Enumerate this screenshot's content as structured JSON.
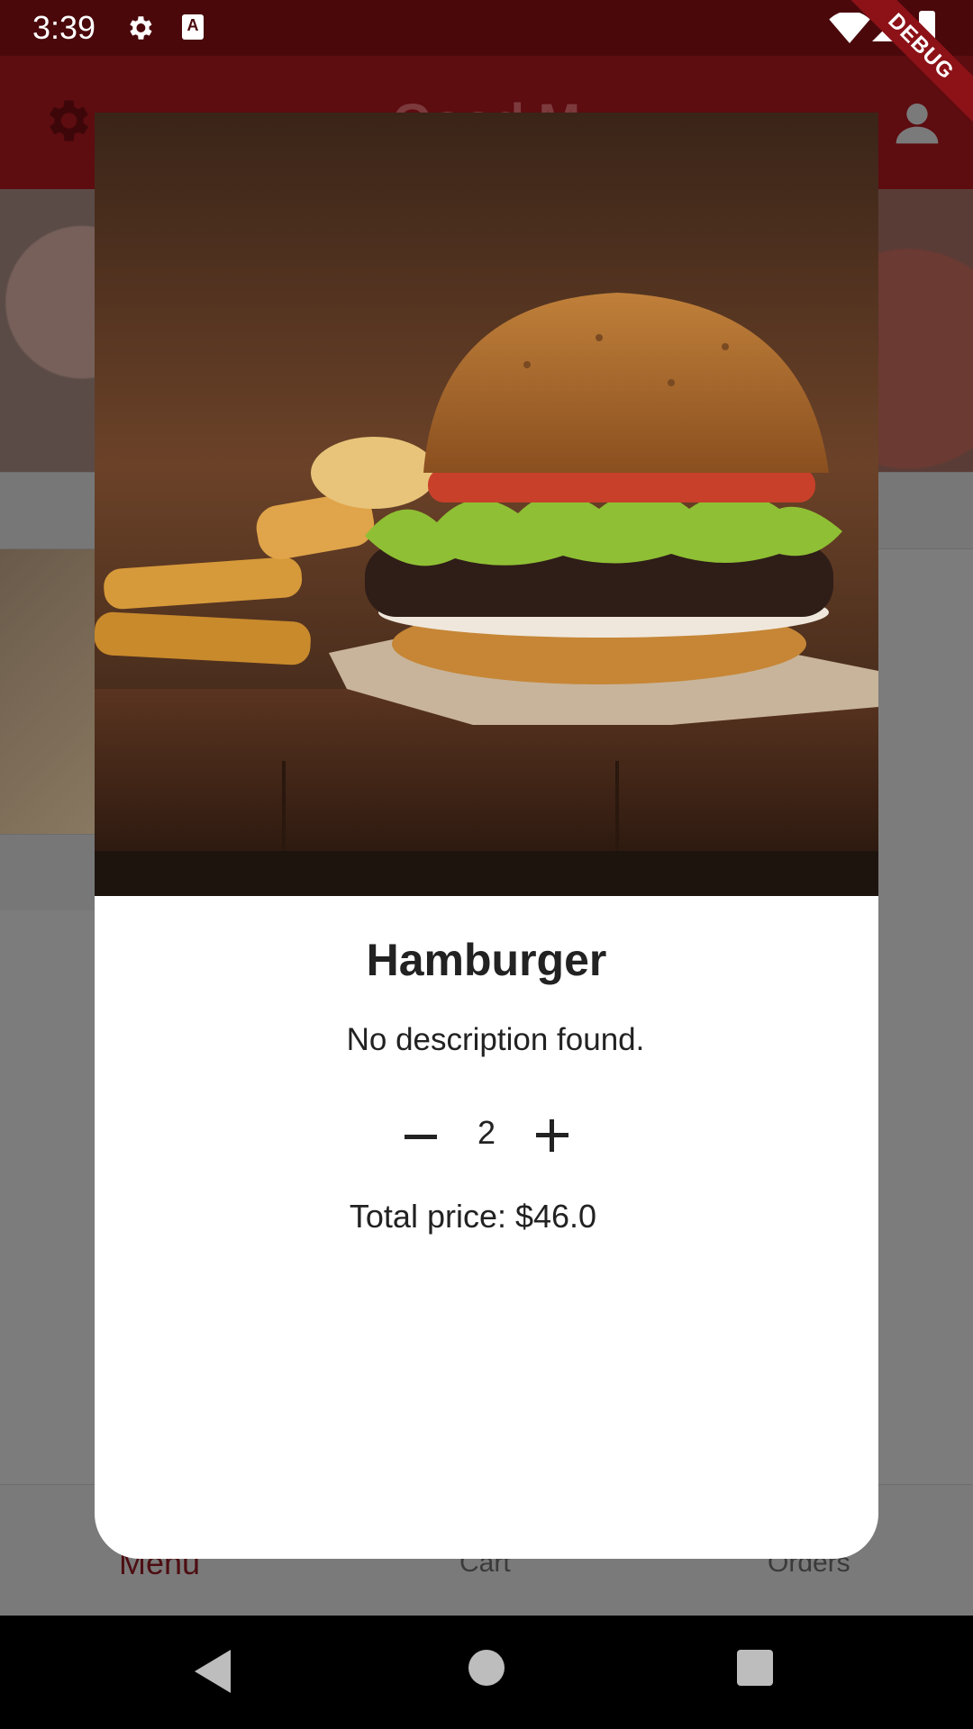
{
  "status_bar": {
    "time": "3:39",
    "icons": [
      "gear-icon",
      "text-a-icon",
      "wifi-icon",
      "signal-icon",
      "battery-icon"
    ]
  },
  "debug_banner": "DEBUG",
  "app_bar": {
    "title": "Good M",
    "left_icon": "settings-gear-icon",
    "right_icon": "account-icon"
  },
  "dialog": {
    "image": "hamburger-photo",
    "title": "Hamburger",
    "description": "No description found.",
    "quantity": "2",
    "total_price": "Total price: $46.0"
  },
  "bottom_nav": {
    "items": [
      {
        "label": "Menu"
      },
      {
        "label": "Cart"
      },
      {
        "label": "Orders"
      }
    ]
  },
  "colors": {
    "status_bar": "#4a080b",
    "app_bar": "#5d0c10",
    "accent": "#8c1218",
    "scrim": "#7a7a7a"
  }
}
